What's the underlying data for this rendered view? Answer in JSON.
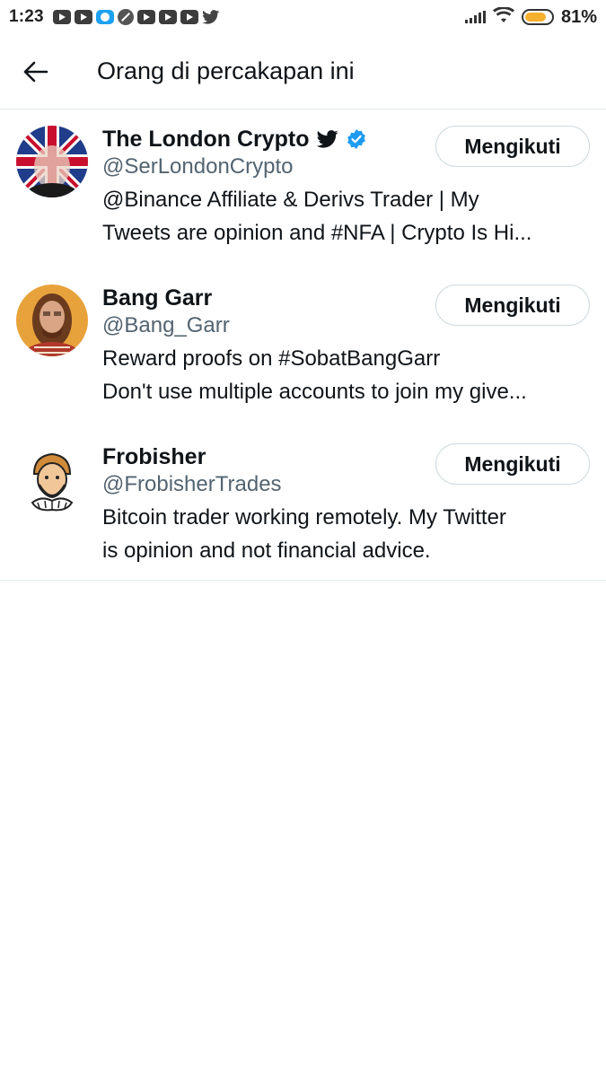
{
  "status_bar": {
    "time": "1:23",
    "battery_percent": "81%",
    "battery_level": 0.81,
    "notification_icons": [
      "youtube-icon",
      "youtube-icon",
      "app-icon",
      "blocked-icon",
      "youtube-icon",
      "youtube-icon",
      "youtube-icon",
      "twitter-icon"
    ]
  },
  "header": {
    "title": "Orang di percakapan ini",
    "back_icon": "arrow-left-icon"
  },
  "users": [
    {
      "display_name": "The London Crypto",
      "handle": "@SerLondonCrypto",
      "badges": [
        "twitter-bird-icon",
        "verified-badge-icon"
      ],
      "bio_line1": "@Binance Affiliate & Derivs Trader | My",
      "bio_line2": "Tweets are opinion and #NFA | Crypto Is Hi...",
      "button_label": "Mengikuti"
    },
    {
      "display_name": "Bang Garr",
      "handle": "@Bang_Garr",
      "badges": [],
      "bio_line1": "Reward proofs on #SobatBangGarr",
      "bio_line2": "Don't use multiple accounts to join my give...",
      "button_label": "Mengikuti"
    },
    {
      "display_name": "Frobisher",
      "handle": "@FrobisherTrades",
      "badges": [],
      "bio_line1": "Bitcoin trader working remotely. My Twitter",
      "bio_line2": "is opinion and not financial advice.",
      "button_label": "Mengikuti"
    }
  ],
  "colors": {
    "accent": "#1d9bf0",
    "text": "#0f1419",
    "secondary_text": "#536471",
    "divider": "#e6ecf0"
  }
}
